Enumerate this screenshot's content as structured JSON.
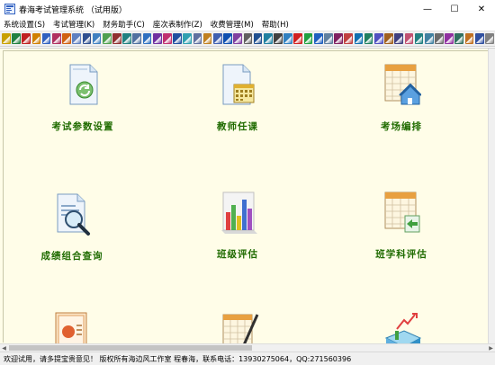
{
  "window": {
    "title": "春海考试管理系统 （试用版）",
    "minimize": "—",
    "maximize": "☐",
    "close": "✕"
  },
  "menu": [
    {
      "label": "系统设置(S)"
    },
    {
      "label": "考试管理(K)"
    },
    {
      "label": "财务助手(C)"
    },
    {
      "label": "座次表制作(Z)"
    },
    {
      "label": "收费管理(M)"
    },
    {
      "label": "帮助(H)"
    }
  ],
  "toolbar": {
    "button_count": 49,
    "colors": [
      "#c8a000",
      "#208040",
      "#c02020",
      "#d08000",
      "#3060c0",
      "#b03060",
      "#d06010",
      "#6080c0",
      "#305090",
      "#4080c0",
      "#50a050",
      "#903030",
      "#208080",
      "#5070a0",
      "#3070c0",
      "#7030a0",
      "#c03070",
      "#2050a0",
      "#30a0b0",
      "#6070a0",
      "#c08020",
      "#4060b0",
      "#1050b0",
      "#8040a0",
      "#606060",
      "#205090",
      "#2080a0",
      "#404040",
      "#3080c0",
      "#d02020",
      "#20a040",
      "#2060c0",
      "#6080a0",
      "#802060",
      "#c04040",
      "#1070b0",
      "#208060",
      "#5050c0",
      "#a06020",
      "#404080",
      "#c05070",
      "#208080",
      "#4080a0",
      "#6a6a6a",
      "#9030a0",
      "#307060",
      "#c07020",
      "#3050a0",
      "#808080"
    ]
  },
  "tiles": [
    {
      "label": "考试参数设置",
      "icon": "document-refresh-icon",
      "name": "exam-parameter-settings"
    },
    {
      "label": "教师任课",
      "icon": "document-calendar-icon",
      "name": "teacher-assignment"
    },
    {
      "label": "考场编排",
      "icon": "calendar-house-icon",
      "name": "exam-room-arrangement"
    },
    {
      "label": "成绩组合查询",
      "icon": "document-magnifier-icon",
      "name": "score-combined-query"
    },
    {
      "label": "班级评估",
      "icon": "bar-chart-icon",
      "name": "class-evaluation"
    },
    {
      "label": "班学科评估",
      "icon": "calendar-arrow-icon",
      "name": "class-subject-evaluation"
    },
    {
      "label": "",
      "icon": "certificate-icon",
      "name": "tile-7"
    },
    {
      "label": "",
      "icon": "document-pen-icon",
      "name": "tile-8"
    },
    {
      "label": "",
      "icon": "chart-arrow-icon",
      "name": "tile-9"
    }
  ],
  "scrollbar": {
    "left_arrow": "◀",
    "right_arrow": "▶"
  },
  "status": {
    "text": "欢迎试用，请多提宝贵意见！ 版权所有海边风工作室 程春海，联系电话：13930275064，QQ:271560396"
  }
}
